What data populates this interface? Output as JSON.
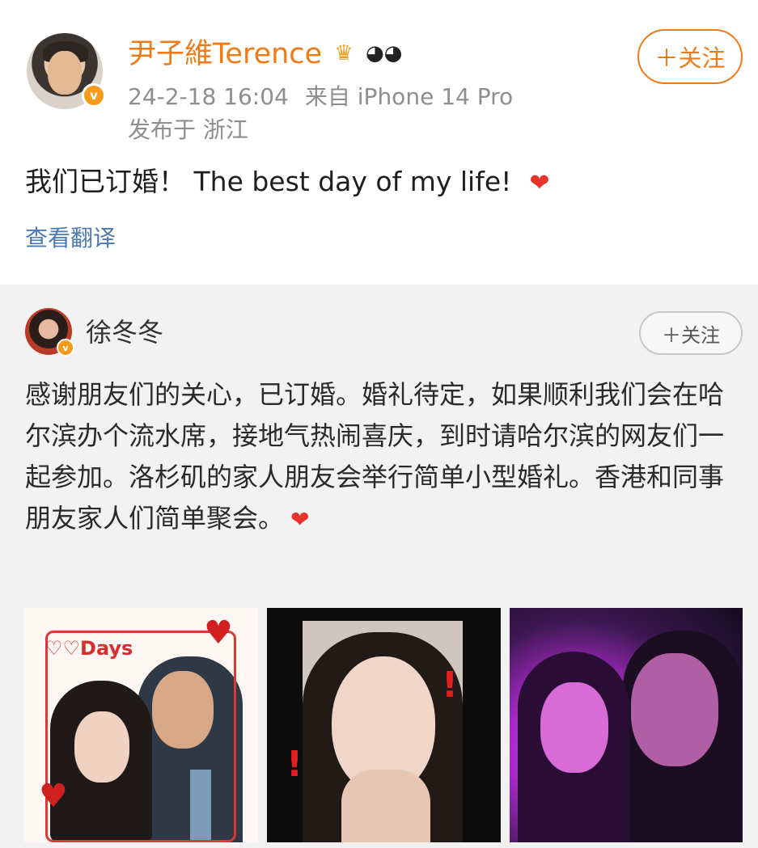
{
  "post": {
    "username": "尹子維Terence",
    "badges": [
      "crown-icon",
      "panda-icon"
    ],
    "date": "24-2-18 16:04",
    "source": "来自 iPhone 14 Pro",
    "location": "发布于 浙江",
    "follow_label": "＋关注",
    "text": "我们已订婚！ The best day of my life!",
    "translate_label": "查看翻译"
  },
  "repost": {
    "username": "徐冬冬",
    "follow_label": "＋关注",
    "text": "感谢朋友们的关心，已订婚。婚礼待定，如果顺利我们会在哈尔滨办个流水席，接地气热闹喜庆，到时请哈尔滨的网友们一起参加。洛杉矶的家人朋友会举行简单小型婚礼。香港和同事朋友家人们简单聚会。",
    "images": [
      "couple-photo-with-hearts",
      "selfie-with-ring",
      "couple-selfie-purple-light"
    ]
  },
  "colors": {
    "accent": "#f07b16",
    "link": "#4c79b4",
    "verified": "#f79a1c",
    "heart": "#e8322c"
  }
}
